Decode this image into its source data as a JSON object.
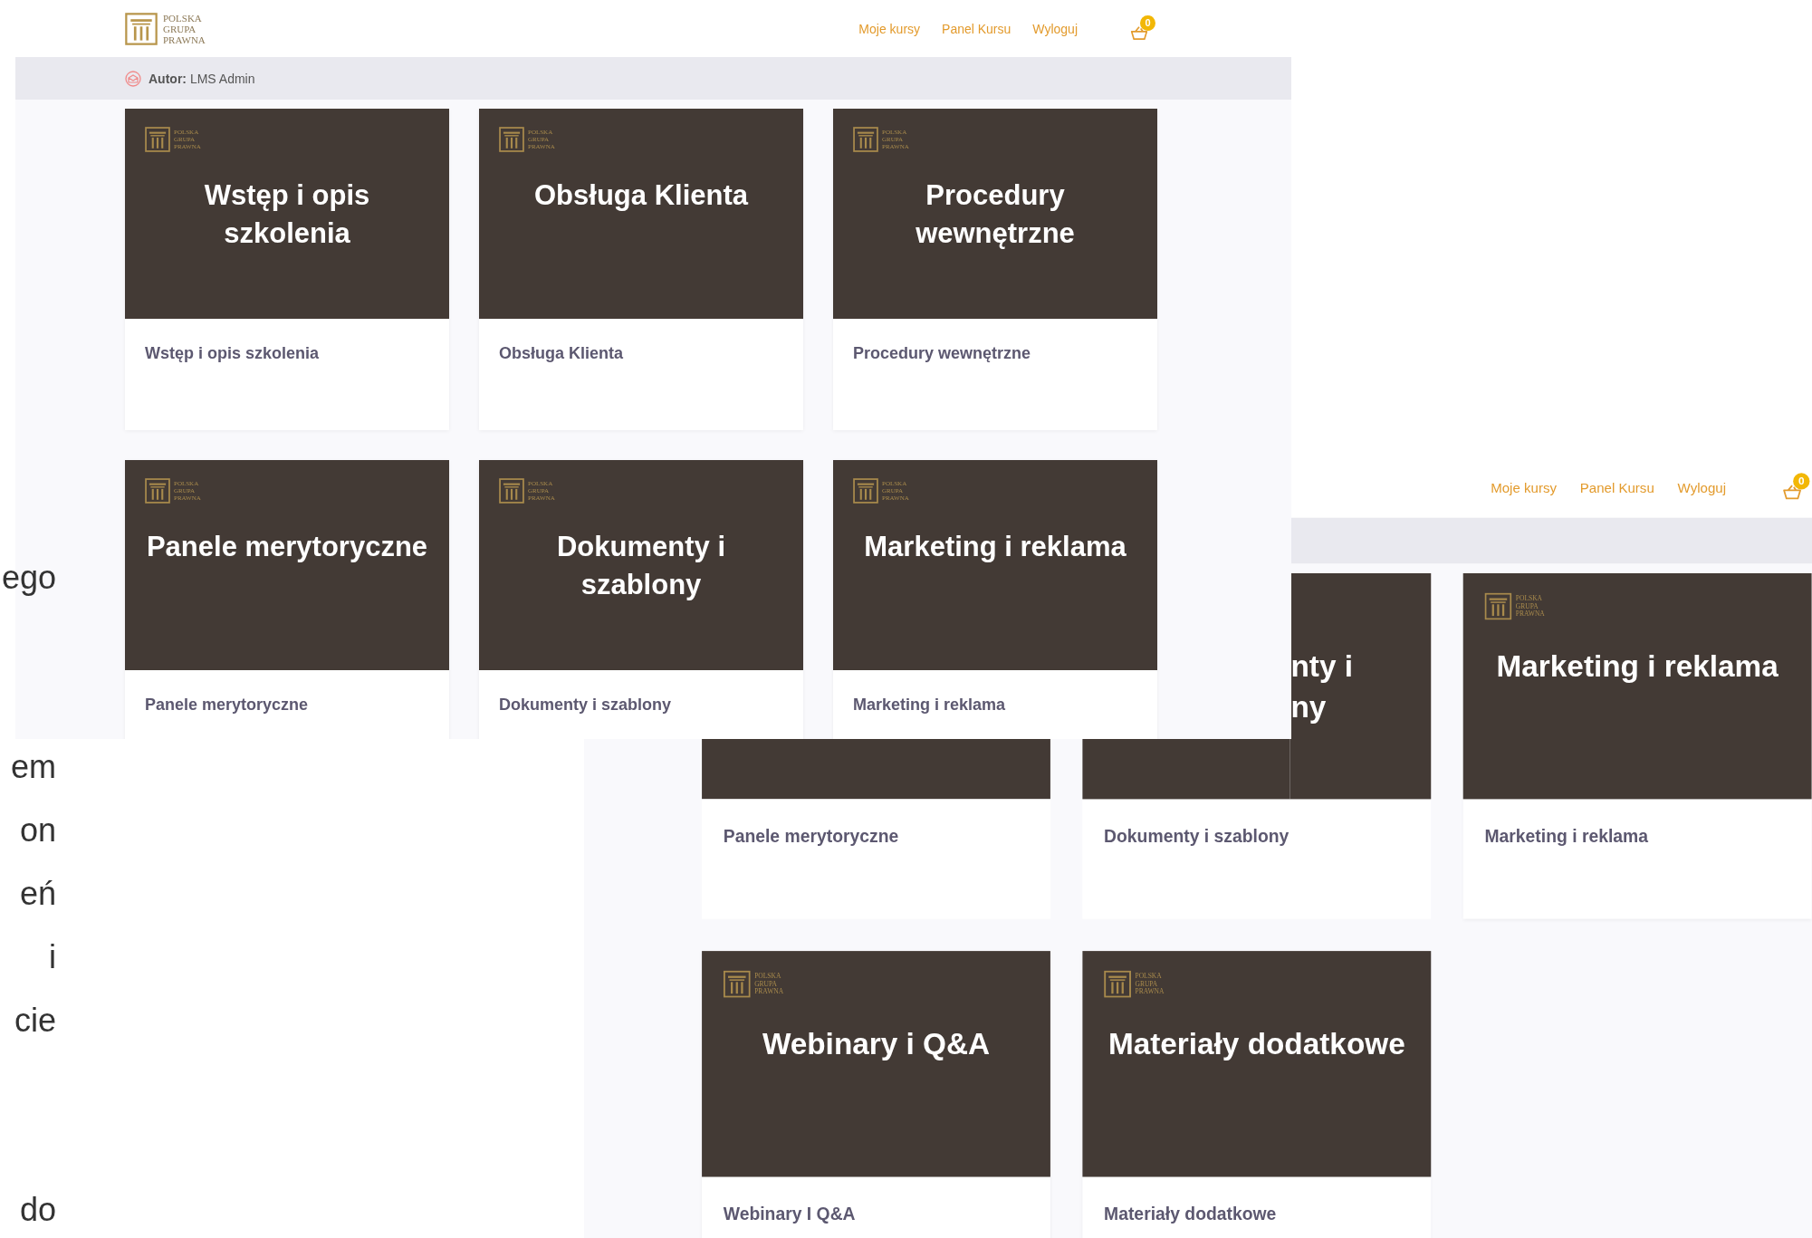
{
  "fragments": [
    [
      "ego"
    ],
    [
      "em",
      "on",
      "eń",
      "i",
      "cie"
    ],
    [
      "do"
    ]
  ],
  "front": {
    "logo": [
      "POLSKA",
      "GRUPA",
      "PRAWNA"
    ],
    "nav": [
      "Moje kursy",
      "Panel Kursu",
      "Wyloguj"
    ],
    "cart_count": "0",
    "author": "**Autor:** LMS Admin",
    "cards": [
      {
        "kind": "full",
        "logo": [
          "POLSKA",
          "GRUPA",
          "PRAWNA"
        ],
        "title_lines": [
          "Wstęp i opis",
          "szkolenia"
        ],
        "subtitle": "Wstęp i opis szkolenia"
      },
      {
        "kind": "full",
        "logo": [
          "POLSKA",
          "GRUPA",
          "PRAWNA"
        ],
        "title_lines": [
          "Obsługa Klienta"
        ],
        "subtitle": "Obsługa Klienta"
      },
      {
        "kind": "full",
        "logo": [
          "POLSKA",
          "GRUPA",
          "PRAWNA"
        ],
        "title_lines": [
          "Procedury",
          "wewnętrzne"
        ],
        "subtitle": "Procedury wewnętrzne"
      },
      {
        "kind": "full",
        "logo": [
          "POLSKA",
          "GRUPA",
          "PRAWNA"
        ],
        "title_lines": [
          "Panele merytoryczne"
        ],
        "subtitle": "Panele merytoryczne"
      },
      {
        "kind": "full",
        "logo": [
          "POLSKA",
          "GRUPA",
          "PRAWNA"
        ],
        "title_lines": [
          "Dokumenty i",
          "szablony"
        ],
        "subtitle": "Dokumenty i szablony"
      },
      {
        "kind": "full",
        "logo": [
          "POLSKA",
          "GRUPA",
          "PRAWNA"
        ],
        "title_lines": [
          "Marketing i reklama"
        ],
        "subtitle": "Marketing i reklama"
      }
    ]
  },
  "back": {
    "nav": [
      "Moje kursy",
      "Panel Kursu",
      "Wyloguj"
    ],
    "cart_count": "0",
    "cards": [
      {
        "kind": "covered",
        "subtitle": "Panele merytoryczne"
      },
      {
        "kind": "cropped",
        "title_lines": [
          "nty i",
          "ny"
        ],
        "subtitle": "Dokumenty i szablony"
      },
      {
        "kind": "full",
        "logo": [
          "POLSKA",
          "GRUPA",
          "PRAWNA"
        ],
        "title_lines": [
          "Marketing i reklama"
        ],
        "subtitle": "Marketing i reklama"
      },
      {
        "kind": "full",
        "logo": [
          "POLSKA",
          "GRUPA",
          "PRAWNA"
        ],
        "title_lines": [
          "Webinary i Q&A"
        ],
        "subtitle": "Webinary I Q&A"
      },
      {
        "kind": "full",
        "logo": [
          "POLSKA",
          "GRUPA",
          "PRAWNA"
        ],
        "title_lines": [
          "Materiały dodatkowe"
        ],
        "subtitle": "Materiały dodatkowe"
      }
    ]
  }
}
